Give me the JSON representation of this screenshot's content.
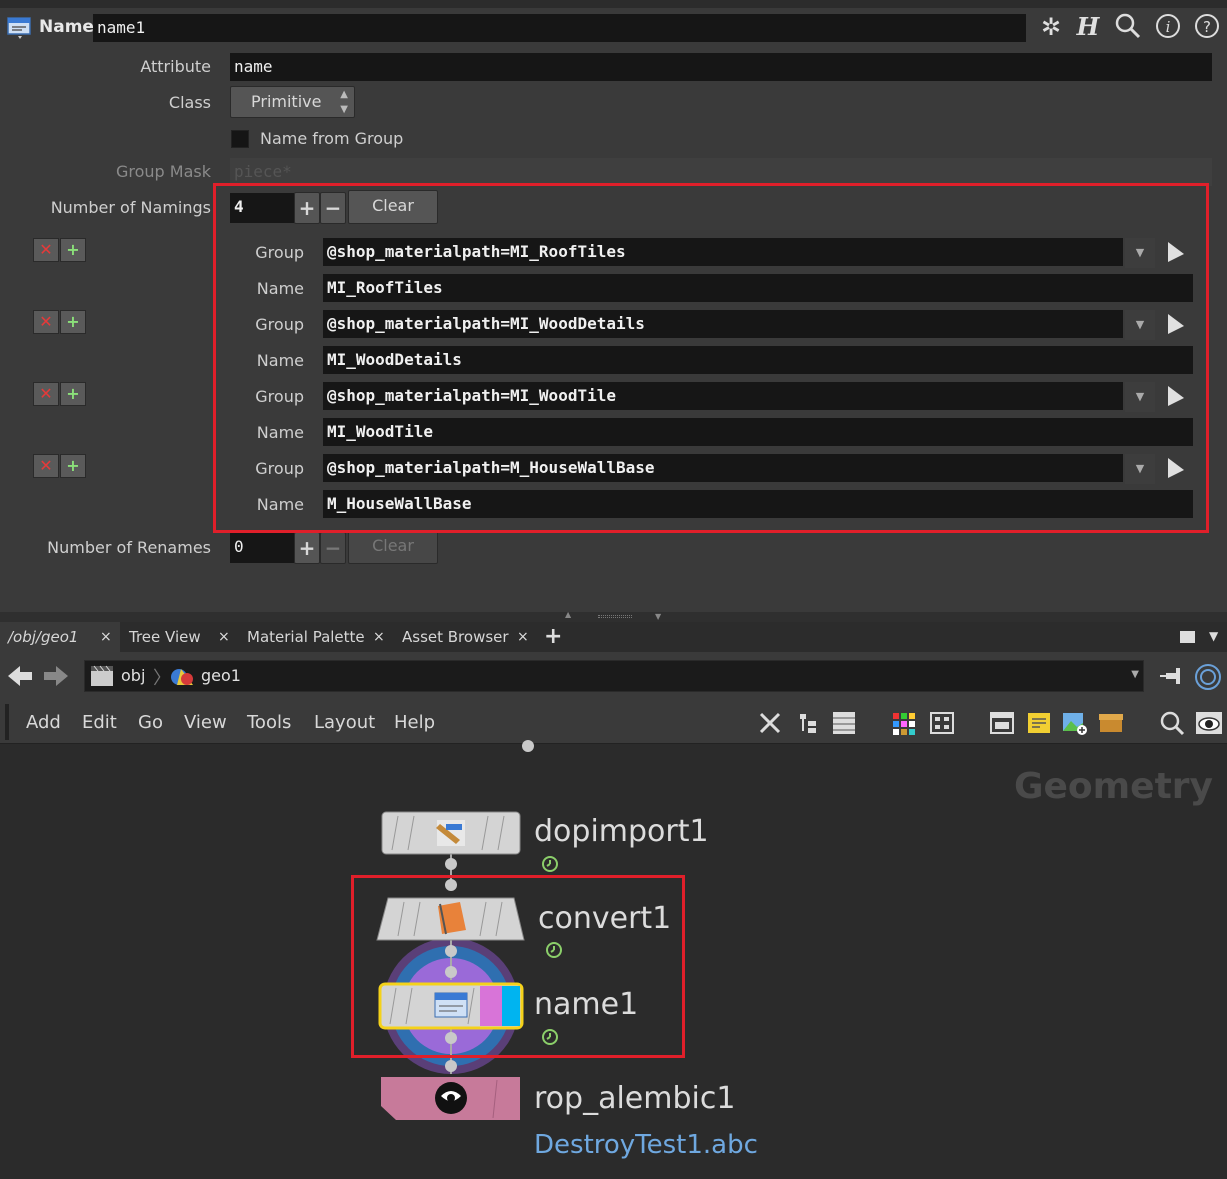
{
  "header": {
    "node_type": "Name",
    "node_name": "name1"
  },
  "params": {
    "attribute_label": "Attribute",
    "attribute_value": "name",
    "class_label": "Class",
    "class_value": "Primitive",
    "name_from_group_label": "Name from Group",
    "group_mask_label": "Group Mask",
    "group_mask_value": "piece*",
    "num_namings_label": "Number of Namings",
    "num_namings_value": "4",
    "clear_label": "Clear",
    "num_renames_label": "Number of Renames",
    "num_renames_value": "0",
    "namings": [
      {
        "group_label": "Group",
        "group": "@shop_materialpath=MI_RoofTiles",
        "name_label": "Name",
        "name": "MI_RoofTiles"
      },
      {
        "group_label": "Group",
        "group": "@shop_materialpath=MI_WoodDetails",
        "name_label": "Name",
        "name": "MI_WoodDetails"
      },
      {
        "group_label": "Group",
        "group": "@shop_materialpath=MI_WoodTile",
        "name_label": "Name",
        "name": "MI_WoodTile"
      },
      {
        "group_label": "Group",
        "group": "@shop_materialpath=M_HouseWallBase",
        "name_label": "Name",
        "name": "M_HouseWallBase"
      }
    ]
  },
  "tabs": [
    {
      "label": "/obj/geo1"
    },
    {
      "label": "Tree View"
    },
    {
      "label": "Material Palette"
    },
    {
      "label": "Asset Browser"
    }
  ],
  "tab_close": "×",
  "tab_add": "+",
  "path": {
    "obj": "obj",
    "geo": "geo1"
  },
  "menu": [
    "Add",
    "Edit",
    "Go",
    "View",
    "Tools",
    "Layout",
    "Help"
  ],
  "network": {
    "context_label": "Geometry",
    "nodes": {
      "dopimport": "dopimport1",
      "convert": "convert1",
      "name": "name1",
      "rop": "rop_alembic1",
      "rop_file": "DestroyTest1.abc"
    }
  },
  "colors": {
    "highlight": "#e01f2a",
    "selected": "#f5d21a",
    "display_flag": "#00b4f0",
    "render_flag": "#d874d8"
  }
}
